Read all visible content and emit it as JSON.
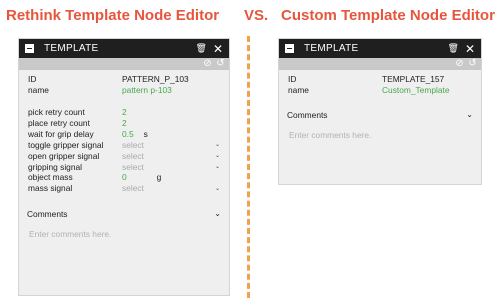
{
  "captions": {
    "left": "Rethink Template Node Editor",
    "vs": "VS.",
    "right": "Custom Template Node Editor"
  },
  "colors": {
    "caption": "#e8553d",
    "divider": "#f0a24c",
    "value_green": "#49a84d",
    "titlebar": "#1f1f1f"
  },
  "left_panel": {
    "title": "TEMPLATE",
    "icons": [
      "minimize-icon",
      "trash-icon",
      "close-icon",
      "disable-icon",
      "reset-icon"
    ],
    "id_label": "ID",
    "id_value": "PATTERN_P_103",
    "name_label": "name",
    "name_value": "pattern p-103",
    "params": [
      {
        "label": "pick retry count",
        "value": "2"
      },
      {
        "label": "place retry count",
        "value": "2"
      },
      {
        "label": "wait for grip delay",
        "value": "0.5",
        "unit": "s"
      },
      {
        "label": "toggle gripper signal",
        "placeholder": "select"
      },
      {
        "label": "open gripper signal",
        "placeholder": "select"
      },
      {
        "label": "gripping signal",
        "placeholder": "select"
      },
      {
        "label": "object mass",
        "value": "0",
        "unit": "g"
      },
      {
        "label": "mass signal",
        "placeholder": "select"
      }
    ],
    "comments_label": "Comments",
    "comments_placeholder": "Enter comments here."
  },
  "right_panel": {
    "title": "TEMPLATE",
    "id_label": "ID",
    "id_value": "TEMPLATE_157",
    "name_label": "name",
    "name_value": "Custom_Template",
    "comments_label": "Comments",
    "comments_placeholder": "Enter comments here."
  }
}
